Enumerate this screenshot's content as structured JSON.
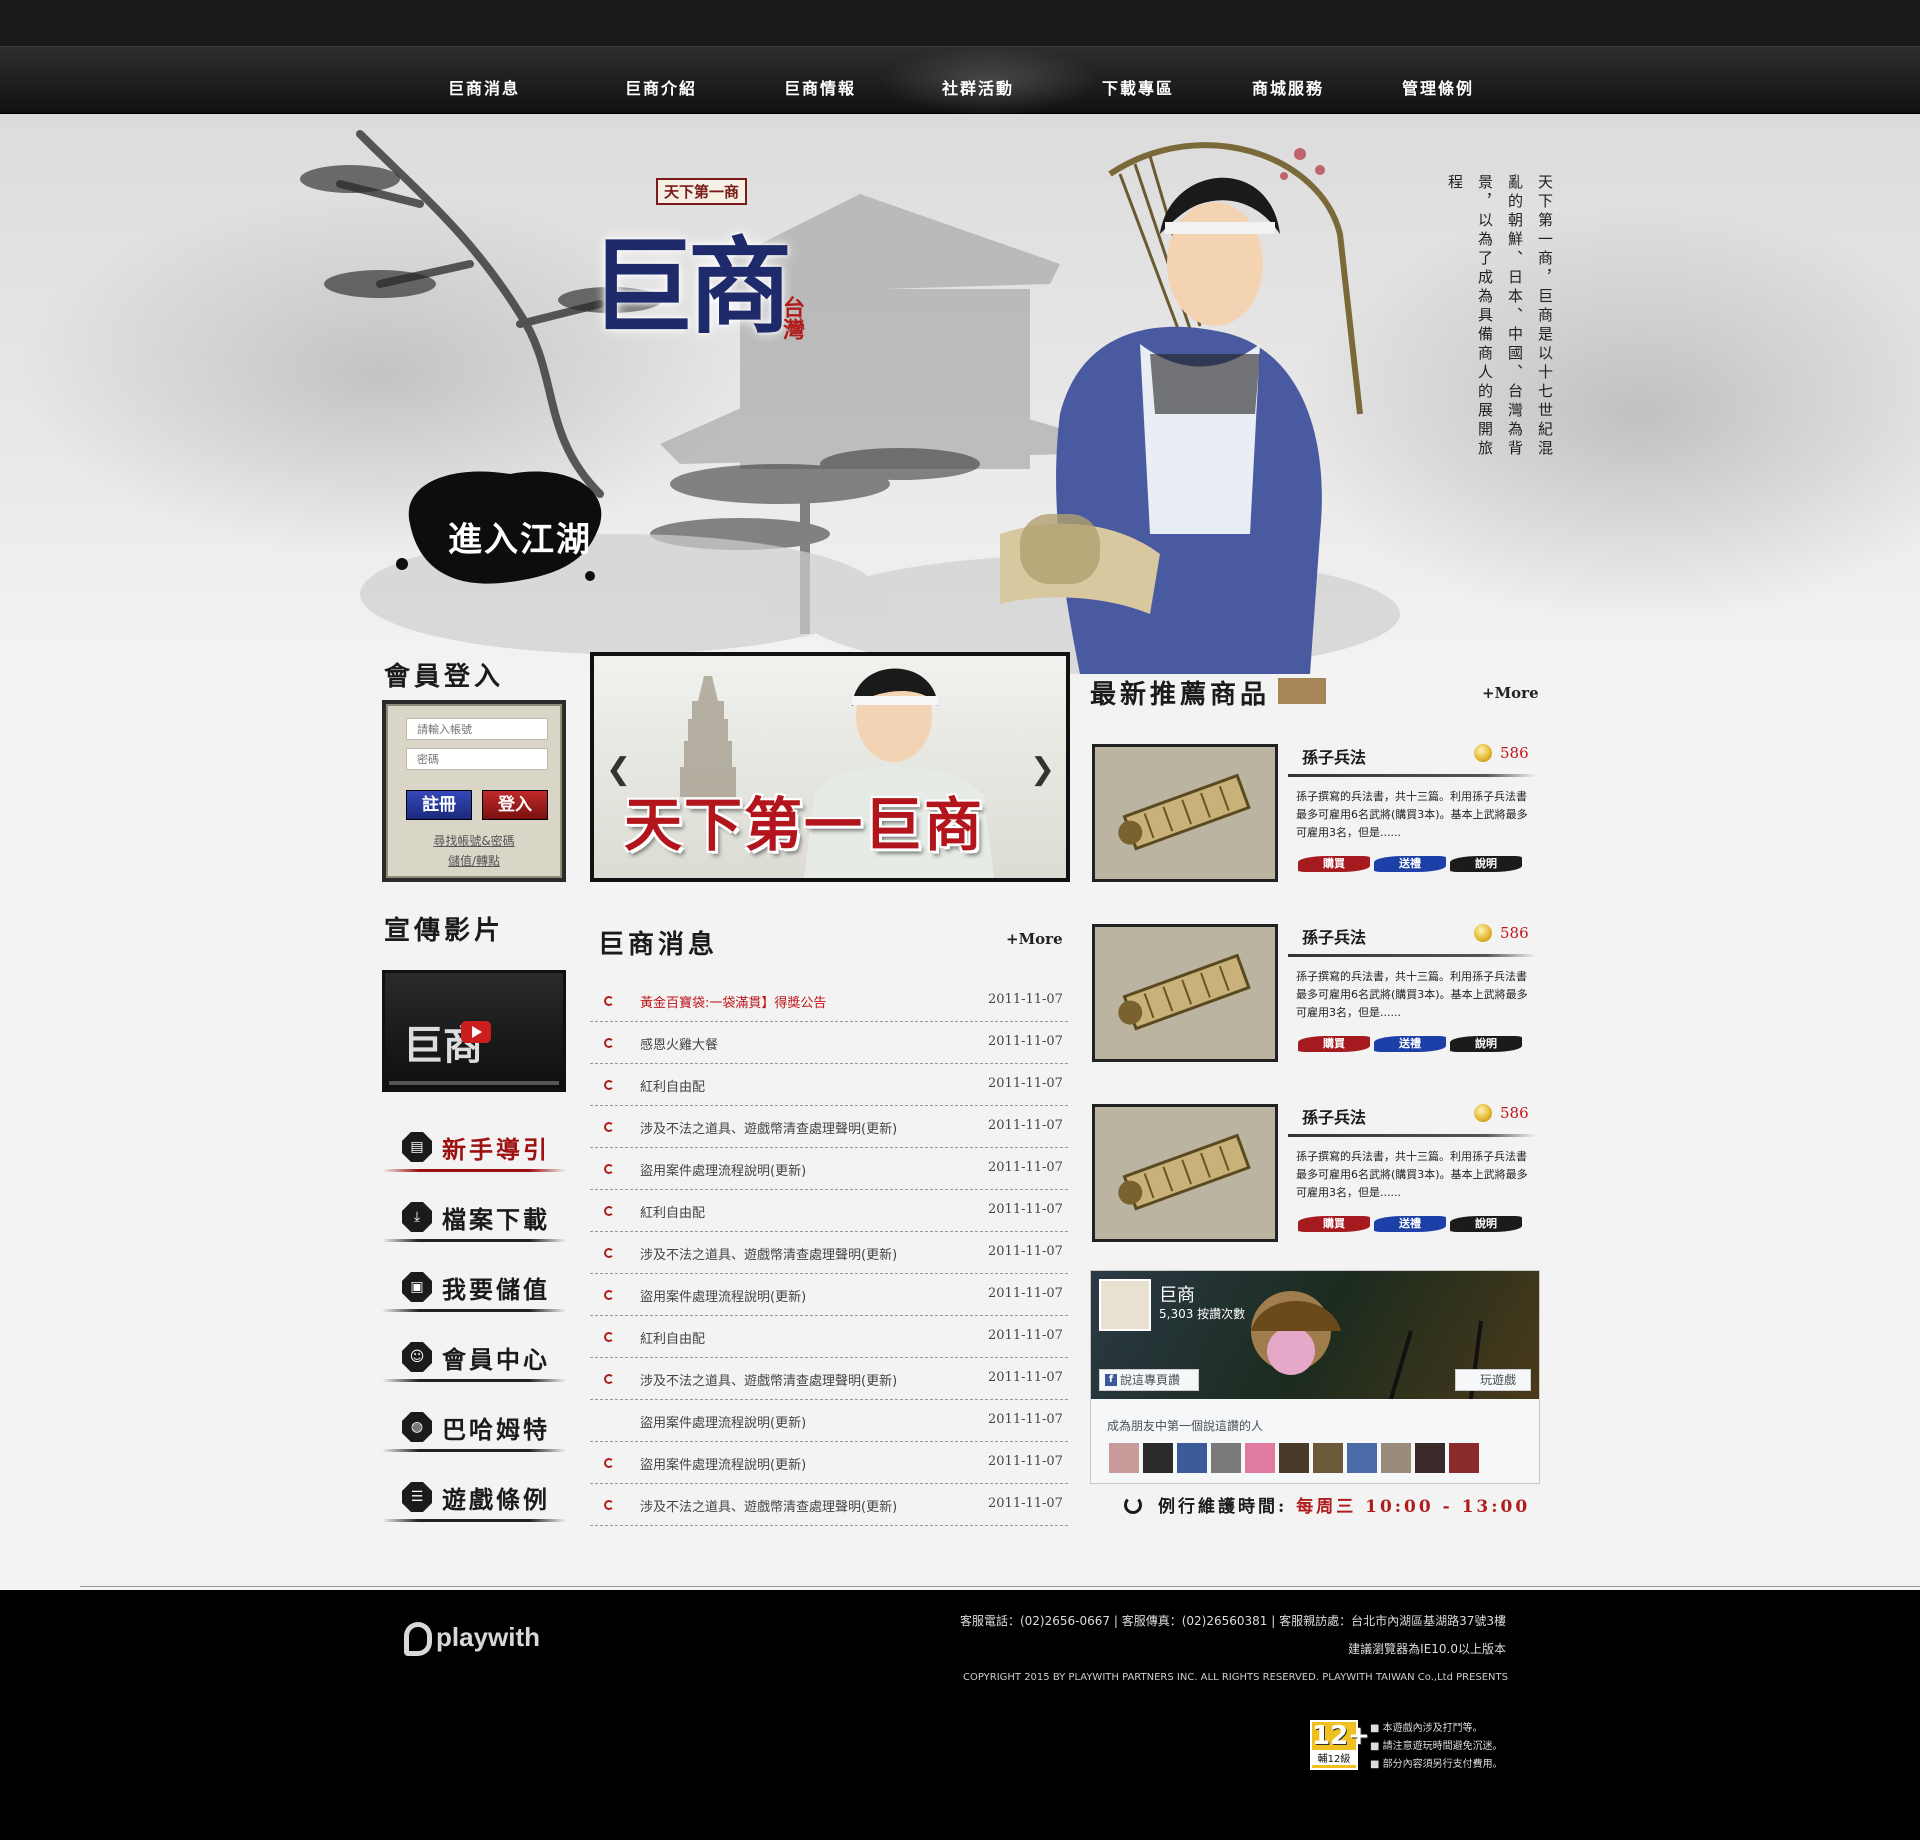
{
  "nav": {
    "items": [
      "巨商消息",
      "巨商介紹",
      "巨商情報",
      "社群活動",
      "下載專區",
      "商城服務",
      "管理條例"
    ]
  },
  "hero": {
    "logo_tag": "天下第一商",
    "logo_main": "巨商",
    "logo_seal": "台灣",
    "intro_text": "天下第一商，巨商是以十七世紀混亂的朝鮮、日本、中國、台灣為背景，以為了成為具備商人的展開旅程",
    "enter_label": "進入江湖"
  },
  "login": {
    "title": "會員登入",
    "username_placeholder": "請輸入帳號",
    "password_placeholder": "密碼",
    "register_label": "註冊",
    "login_label": "登入",
    "find_account_link": "尋找帳號&密碼",
    "topup_link": "儲值/轉點"
  },
  "banner": {
    "title": "天下第一巨商"
  },
  "video": {
    "title": "宣傳影片",
    "logo_text": "巨商"
  },
  "side_menu": [
    {
      "label": "新手導引",
      "icon": "book-icon",
      "glyph": "▤",
      "active": true
    },
    {
      "label": "檔案下載",
      "icon": "download-icon",
      "glyph": "⤓",
      "active": false
    },
    {
      "label": "我要儲值",
      "icon": "wallet-icon",
      "glyph": "▣",
      "active": false
    },
    {
      "label": "會員中心",
      "icon": "member-icon",
      "glyph": "☺",
      "active": false
    },
    {
      "label": "巴哈姆特",
      "icon": "forum-icon",
      "glyph": "◍",
      "active": false
    },
    {
      "label": "遊戲條例",
      "icon": "list-icon",
      "glyph": "☰",
      "active": false
    }
  ],
  "news": {
    "title": "巨商消息",
    "more_label": "+More",
    "items": [
      {
        "title": "黃金百寶袋:一袋滿貫】得獎公告",
        "date": "2011-11-07",
        "hot": true,
        "bullet": true
      },
      {
        "title": "感恩火雞大餐",
        "date": "2011-11-07",
        "hot": false,
        "bullet": true
      },
      {
        "title": "紅利自由配",
        "date": "2011-11-07",
        "hot": false,
        "bullet": true
      },
      {
        "title": "涉及不法之道具、遊戲幣清查處理聲明(更新)",
        "date": "2011-11-07",
        "hot": false,
        "bullet": true
      },
      {
        "title": "盜用案件處理流程說明(更新)",
        "date": "2011-11-07",
        "hot": false,
        "bullet": true
      },
      {
        "title": "紅利自由配",
        "date": "2011-11-07",
        "hot": false,
        "bullet": true
      },
      {
        "title": "涉及不法之道具、遊戲幣清查處理聲明(更新)",
        "date": "2011-11-07",
        "hot": false,
        "bullet": true
      },
      {
        "title": "盜用案件處理流程說明(更新)",
        "date": "2011-11-07",
        "hot": false,
        "bullet": true
      },
      {
        "title": "紅利自由配",
        "date": "2011-11-07",
        "hot": false,
        "bullet": true
      },
      {
        "title": "涉及不法之道具、遊戲幣清查處理聲明(更新)",
        "date": "2011-11-07",
        "hot": false,
        "bullet": true
      },
      {
        "title": "盜用案件處理流程說明(更新)",
        "date": "2011-11-07",
        "hot": false,
        "bullet": false
      },
      {
        "title": "盜用案件處理流程說明(更新)",
        "date": "2011-11-07",
        "hot": false,
        "bullet": true
      },
      {
        "title": "涉及不法之道具、遊戲幣清查處理聲明(更新)",
        "date": "2011-11-07",
        "hot": false,
        "bullet": true
      }
    ]
  },
  "products": {
    "title": "最新推薦商品",
    "more_label": "+More",
    "items": [
      {
        "name": "孫子兵法",
        "price": "586",
        "desc": "孫子撰寫的兵法書，共十三篇。利用孫子兵法書最多可雇用6名武將(購買3本)。基本上武將最多可雇用3名，但是......",
        "buy": "購買",
        "gift": "送禮",
        "info": "說明"
      },
      {
        "name": "孫子兵法",
        "price": "586",
        "desc": "孫子撰寫的兵法書，共十三篇。利用孫子兵法書最多可雇用6名武將(購買3本)。基本上武將最多可雇用3名，但是......",
        "buy": "購買",
        "gift": "送禮",
        "info": "說明"
      },
      {
        "name": "孫子兵法",
        "price": "586",
        "desc": "孫子撰寫的兵法書，共十三篇。利用孫子兵法書最多可雇用6名武將(購買3本)。基本上武將最多可雇用3名，但是......",
        "buy": "購買",
        "gift": "送禮",
        "info": "說明"
      }
    ]
  },
  "facebook": {
    "page_name": "巨商",
    "likes": "5,303 按讚次數",
    "like_button": "說這專頁讚",
    "play_button": "玩遊戲",
    "friends_text": "成為朋友中第一個說這讚的人"
  },
  "maintenance": {
    "label": "例行維護時間:",
    "time": "每周三 10:00 - 13:00"
  },
  "footer": {
    "logo": "playwith",
    "contact": "客服電話：(02)2656-0667 | 客服傳真：(02)26560381 | 客服親訪處：台北市內湖區基湖路37號3樓",
    "browser": "建議瀏覽器為IE10.0以上版本",
    "copyright": "COPYRIGHT 2015 BY PLAYWITH PARTNERS INC. ALL RIGHTS RESERVED. PLAYWITH TAIWAN Co.,Ltd PRESENTS",
    "rating_number": "12+",
    "rating_label": "輔12級",
    "notes": [
      "■ 本遊戲內涉及打鬥等。",
      "■ 請注意遊玩時間避免沉迷。",
      "■ 部分內容須另行支付費用。"
    ]
  },
  "colors": {
    "accent_red": "#b01c1c",
    "nav_bg": "#111111",
    "ink": "#1b1b1b",
    "register_blue": "#1b2a7d",
    "facebook_blue": "#3b5998"
  }
}
